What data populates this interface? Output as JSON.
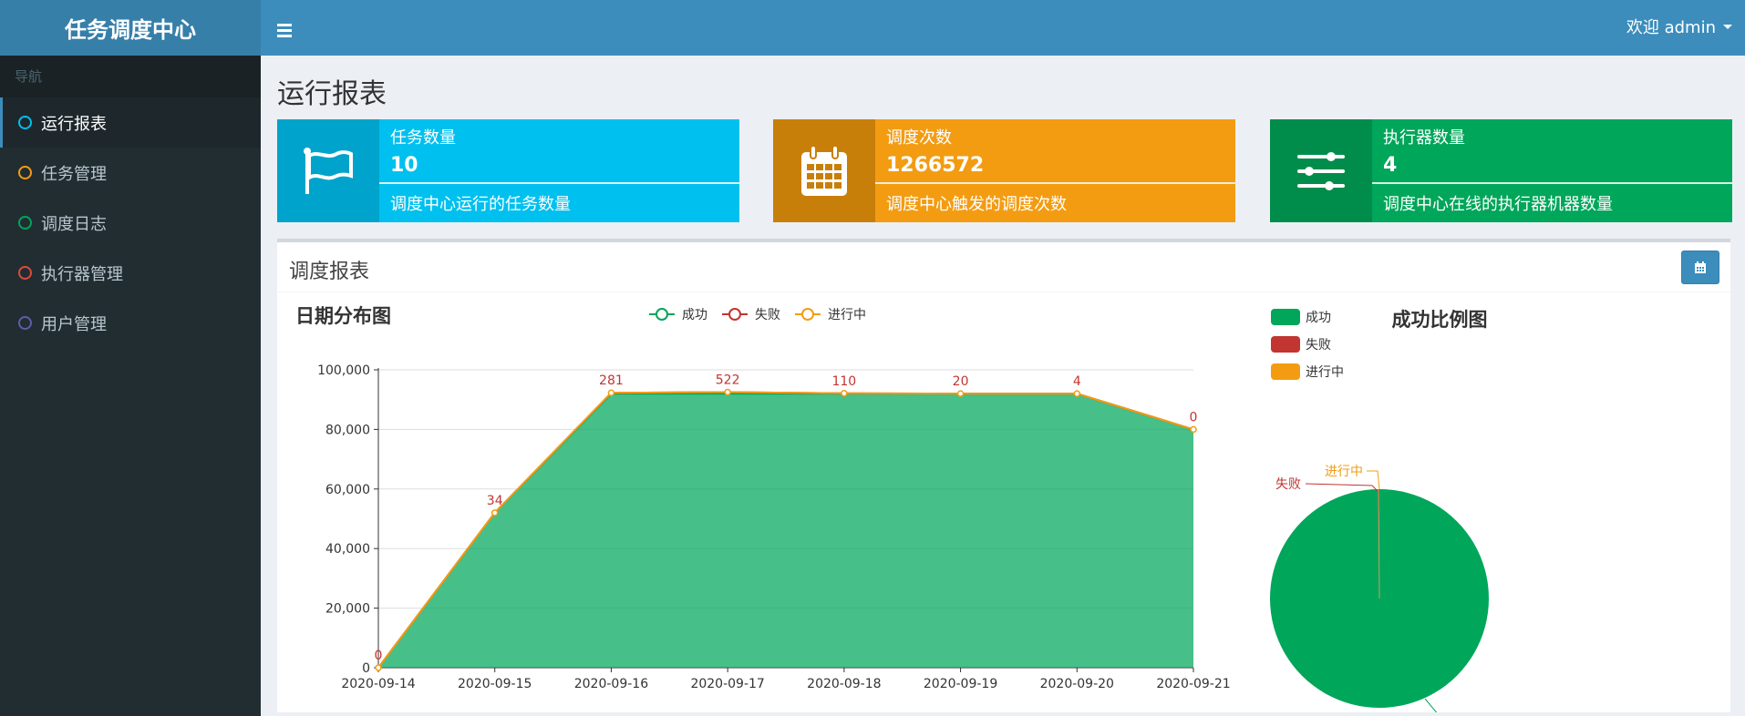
{
  "app": {
    "title": "任务调度中心",
    "user": "欢迎 admin"
  },
  "sidebar": {
    "header": "导航",
    "items": [
      {
        "label": "运行报表",
        "color": "#00c0ef",
        "active": true
      },
      {
        "label": "任务管理",
        "color": "#f39c12"
      },
      {
        "label": "调度日志",
        "color": "#00a65a"
      },
      {
        "label": "执行器管理",
        "color": "#dd4b39"
      },
      {
        "label": "用户管理",
        "color": "#605ca8"
      }
    ]
  },
  "page": {
    "title": "运行报表"
  },
  "info_boxes": [
    {
      "label": "任务数量",
      "value": "10",
      "desc": "调度中心运行的任务数量",
      "icon": "flag-icon",
      "bg": "#00c0ef",
      "icon_bg": "#00a3cb"
    },
    {
      "label": "调度次数",
      "value": "1266572",
      "desc": "调度中心触发的调度次数",
      "icon": "calendar-icon",
      "bg": "#f39c12",
      "icon_bg": "#c87f0a"
    },
    {
      "label": "执行器数量",
      "value": "4",
      "desc": "调度中心在线的执行器机器数量",
      "icon": "sliders-icon",
      "bg": "#00a65a",
      "icon_bg": "#008d4c"
    }
  ],
  "report": {
    "title": "调度报表",
    "button_icon": "calendar-icon"
  },
  "chart_data": [
    {
      "type": "area",
      "title": "日期分布图",
      "categories": [
        "2020-09-14",
        "2020-09-15",
        "2020-09-16",
        "2020-09-17",
        "2020-09-18",
        "2020-09-19",
        "2020-09-20",
        "2020-09-21"
      ],
      "ylim": [
        0,
        100000
      ],
      "yticks": [
        "0",
        "20,000",
        "40,000",
        "60,000",
        "80,000",
        "100,000"
      ],
      "grid": true,
      "legend": "top-center",
      "series": [
        {
          "name": "成功",
          "color": "#00a65a",
          "values": [
            0,
            52000,
            92000,
            92000,
            92000,
            92000,
            92000,
            80000
          ]
        },
        {
          "name": "失败",
          "color": "#c23531",
          "values": [
            0,
            34,
            281,
            522,
            110,
            20,
            4,
            0
          ]
        },
        {
          "name": "进行中",
          "color": "#f39c12",
          "values": [
            0,
            0,
            0,
            0,
            0,
            0,
            0,
            0
          ]
        }
      ],
      "data_labels": [
        "0",
        "34",
        "281",
        "522",
        "110",
        "20",
        "4",
        "0"
      ]
    },
    {
      "type": "pie",
      "title": "成功比例图",
      "legend": "left",
      "slices": [
        {
          "name": "成功",
          "color": "#00a65a",
          "value": 1266000
        },
        {
          "name": "失败",
          "color": "#c23531",
          "value": 971
        },
        {
          "name": "进行中",
          "color": "#f39c12",
          "value": 0
        }
      ]
    }
  ]
}
